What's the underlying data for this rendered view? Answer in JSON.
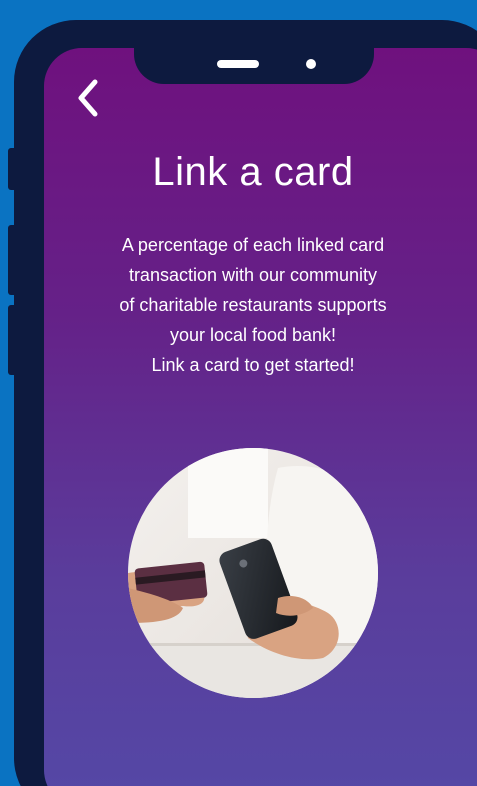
{
  "screen": {
    "title": "Link a card",
    "description_lines": [
      "A percentage of each linked card",
      "transaction with our community",
      "of charitable restaurants supports",
      "your local food bank!",
      "Link a card to get started!"
    ],
    "back_icon": "chevron-left-icon",
    "image_subject": "hands holding credit card and smartphone"
  },
  "colors": {
    "background": "#0a73c2",
    "phone_frame": "#0d1a3f",
    "gradient_top": "#6f117e",
    "gradient_bottom": "#5448a6",
    "text": "#ffffff"
  }
}
